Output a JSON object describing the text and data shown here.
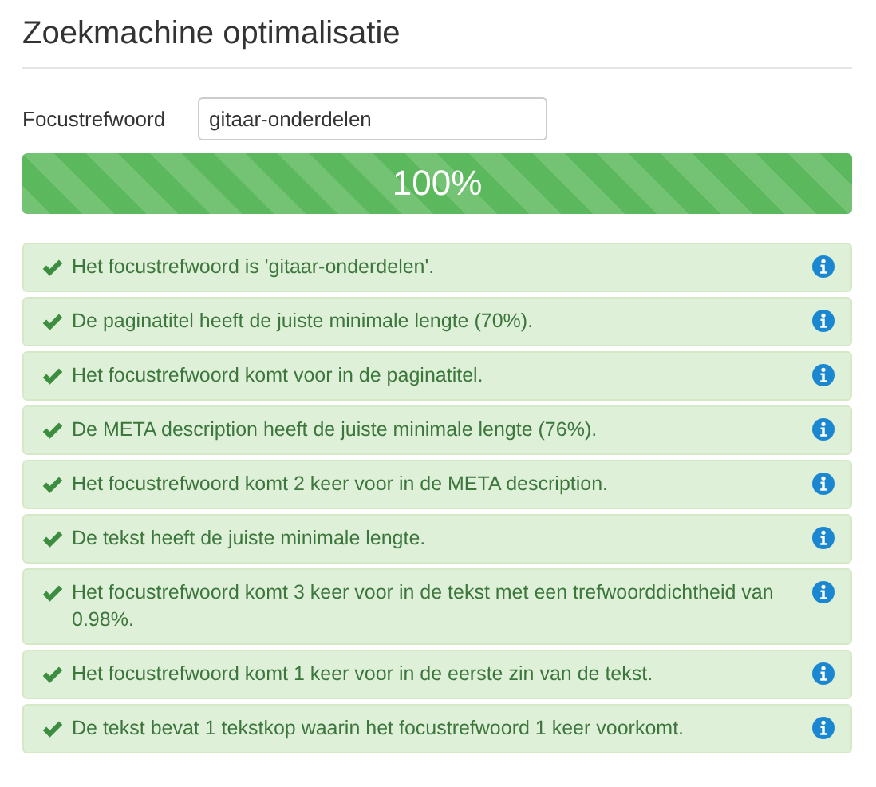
{
  "title": "Zoekmachine optimalisatie",
  "focus_keyword": {
    "label": "Focustrefwoord",
    "value": "gitaar-onderdelen"
  },
  "progress": {
    "level": 1,
    "text": "100%"
  },
  "checks": [
    {
      "passed": true,
      "text": "Het focustrefwoord is 'gitaar-onderdelen'."
    },
    {
      "passed": true,
      "text": "De paginatitel heeft de juiste minimale lengte (70%)."
    },
    {
      "passed": true,
      "text": "Het focustrefwoord komt voor in de paginatitel."
    },
    {
      "passed": true,
      "text": "De META description heeft de juiste minimale lengte (76%)."
    },
    {
      "passed": true,
      "text": "Het focustrefwoord komt 2 keer voor in de META description."
    },
    {
      "passed": true,
      "text": "De tekst heeft de juiste minimale lengte."
    },
    {
      "passed": true,
      "text": "Het focustrefwoord komt 3 keer voor in de tekst met een trefwoorddichtheid van 0.98%."
    },
    {
      "passed": true,
      "text": "Het focustrefwoord komt 1 keer voor in de eerste zin van de tekst."
    },
    {
      "passed": true,
      "text": "De tekst bevat 1 tekstkop waarin het focustrefwoord 1 keer voorkomt."
    }
  ]
}
